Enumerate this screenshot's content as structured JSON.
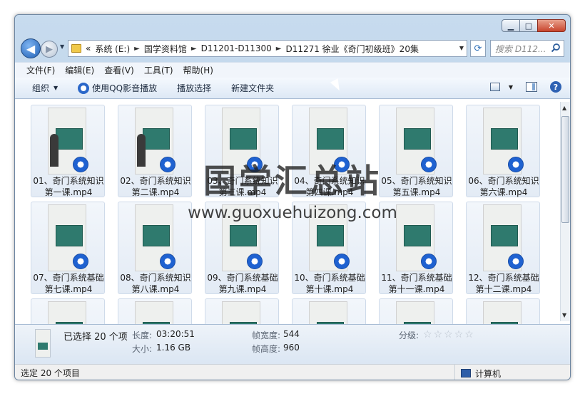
{
  "window": {
    "caption": {
      "minimize": "▁",
      "maximize": "□",
      "close": "✕"
    }
  },
  "address": {
    "overflow": "«",
    "crumbs": [
      "系统 (E:)",
      "国学资料馆",
      "D11201-D11300",
      "D11271 徐业《奇门初级班》20集"
    ],
    "separator": "►"
  },
  "search": {
    "placeholder": "搜索 D112..."
  },
  "menu": [
    "文件(F)",
    "编辑(E)",
    "查看(V)",
    "工具(T)",
    "帮助(H)"
  ],
  "toolbar": {
    "organize": "组织",
    "play_qq": "使用QQ影音播放",
    "play_selection": "播放选择",
    "new_folder": "新建文件夹"
  },
  "files": [
    {
      "name": "01、奇门系统知识第一课.mp4",
      "person": true
    },
    {
      "name": "02、奇门系统知识第二课.mp4",
      "person": true
    },
    {
      "name": "03、奇门系统知识第三课.mp4",
      "person": false
    },
    {
      "name": "04、奇门系统知识第四课.mp4",
      "person": false
    },
    {
      "name": "05、奇门系统知识第五课.mp4",
      "person": false
    },
    {
      "name": "06、奇门系统知识第六课.mp4",
      "person": false
    },
    {
      "name": "07、奇门系统基础第七课.mp4",
      "person": false
    },
    {
      "name": "08、奇门系统知识第八课.mp4",
      "person": false
    },
    {
      "name": "09、奇门系统基础第九课.mp4",
      "person": false
    },
    {
      "name": "10、奇门系统基础第十课.mp4",
      "person": false
    },
    {
      "name": "11、奇门系统基础第十一课.mp4",
      "person": false
    },
    {
      "name": "12、奇门系统基础第十二课.mp4",
      "person": false
    },
    {
      "name": "",
      "person": false
    },
    {
      "name": "",
      "person": false
    },
    {
      "name": "",
      "person": false
    },
    {
      "name": "",
      "person": false
    },
    {
      "name": "",
      "person": false
    },
    {
      "name": "",
      "person": false
    }
  ],
  "watermark": {
    "title": "国学汇总站",
    "url": "www.guoxuehuizong.com"
  },
  "details": {
    "selected": "已选择 20 个项",
    "length_label": "长度:",
    "length_value": "03:20:51",
    "size_label": "大小:",
    "size_value": "1.16 GB",
    "frame_width_label": "帧宽度:",
    "frame_width_value": "544",
    "frame_height_label": "帧高度:",
    "frame_height_value": "960",
    "rating_label": "分级:",
    "rating_stars": 0
  },
  "status": {
    "left": "选定 20 个项目",
    "right": "计算机"
  },
  "colors": {
    "accent": "#2a67c9",
    "board": "#2f7a6e",
    "window_frame": "#c7dbee"
  }
}
